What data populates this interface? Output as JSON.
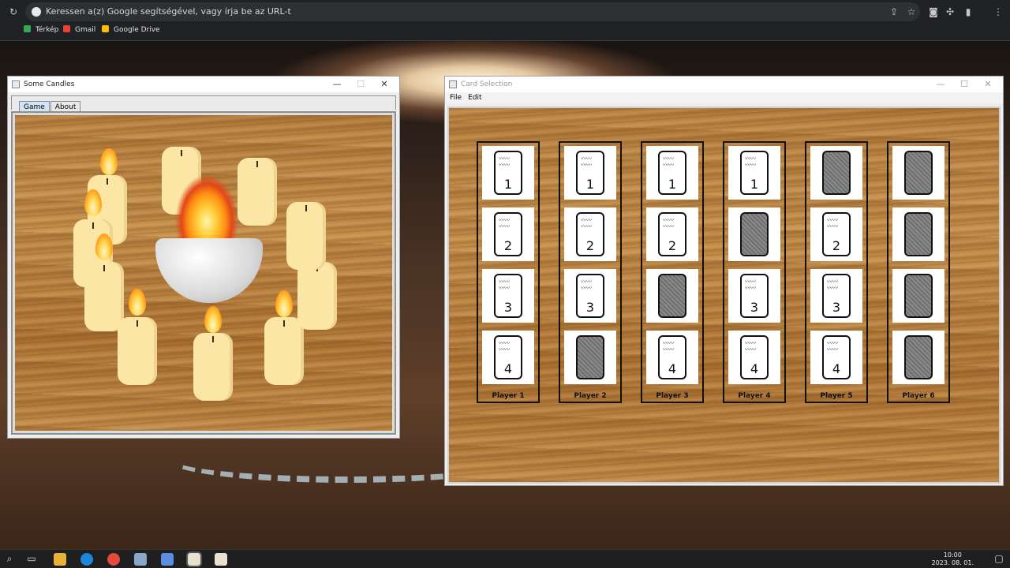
{
  "browser": {
    "omnibox_placeholder": "Keressen a(z) Google segítségével, vagy írja be az URL-t",
    "bookmarks": [
      {
        "label": "Térkép",
        "icon": "maps-icon",
        "color": "#34a853"
      },
      {
        "label": "Gmail",
        "icon": "gmail-icon",
        "color": "#ea4335"
      },
      {
        "label": "Google Drive",
        "icon": "drive-icon",
        "color": "#fbbc04"
      }
    ]
  },
  "candles_window": {
    "title": "Some Candles",
    "tabs": [
      "Game",
      "About"
    ],
    "active_tab": "Game"
  },
  "cards_window": {
    "title": "Card Selection",
    "menu": [
      "File",
      "Edit"
    ],
    "players": [
      {
        "name": "Player 1",
        "cards": [
          "1",
          "2",
          "3",
          "4"
        ]
      },
      {
        "name": "Player 2",
        "cards": [
          "1",
          "2",
          "3",
          "back"
        ]
      },
      {
        "name": "Player 3",
        "cards": [
          "1",
          "2",
          "back",
          "4"
        ]
      },
      {
        "name": "Player 4",
        "cards": [
          "1",
          "back",
          "3",
          "4"
        ]
      },
      {
        "name": "Player 5",
        "cards": [
          "back",
          "2",
          "3",
          "4"
        ]
      },
      {
        "name": "Player 6",
        "cards": [
          "back",
          "back",
          "back",
          "back"
        ]
      }
    ],
    "card_scribble": "Mw\nWW"
  },
  "taskbar": {
    "time": "10:00",
    "date": "2023. 08. 01."
  }
}
